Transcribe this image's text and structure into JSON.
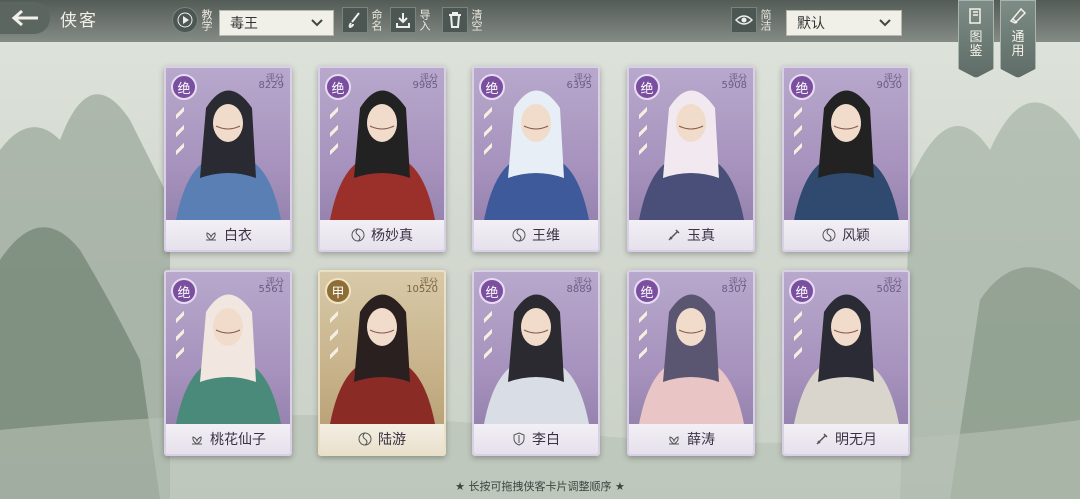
{
  "header": {
    "title": "侠客",
    "tutorial_label": "教学",
    "filter_selected": "毒王",
    "rename_label": "命名",
    "import_label": "导入",
    "clear_label": "清空",
    "simple_label": "简洁",
    "sort_selected": "默认",
    "atlas_label": "图鉴",
    "general_label": "通用"
  },
  "score_label": "评分",
  "cards": [
    {
      "rank": "绝",
      "score": "8229",
      "name": "白衣",
      "icon": "lotus-icon",
      "tier": "purple"
    },
    {
      "rank": "绝",
      "score": "9985",
      "name": "杨妙真",
      "icon": "swirl-icon",
      "tier": "purple"
    },
    {
      "rank": "绝",
      "score": "6395",
      "name": "王维",
      "icon": "swirl-icon",
      "tier": "purple"
    },
    {
      "rank": "绝",
      "score": "5908",
      "name": "玉真",
      "icon": "sword-icon",
      "tier": "purple"
    },
    {
      "rank": "绝",
      "score": "9030",
      "name": "风颖",
      "icon": "swirl-icon",
      "tier": "purple"
    },
    {
      "rank": "绝",
      "score": "5561",
      "name": "桃花仙子",
      "icon": "lotus-icon",
      "tier": "purple"
    },
    {
      "rank": "甲",
      "score": "10520",
      "name": "陆游",
      "icon": "swirl-icon",
      "tier": "gold"
    },
    {
      "rank": "绝",
      "score": "8889",
      "name": "李白",
      "icon": "shield-icon",
      "tier": "purple"
    },
    {
      "rank": "绝",
      "score": "8307",
      "name": "薛涛",
      "icon": "lotus-icon",
      "tier": "purple"
    },
    {
      "rank": "绝",
      "score": "5082",
      "name": "明无月",
      "icon": "sword-icon",
      "tier": "purple"
    }
  ],
  "footer": {
    "hint": "★ 长按可拖拽侠客卡片调整顺序 ★"
  },
  "colors": {
    "purple_card": "#a692bd",
    "gold_card": "#c7b28a",
    "topbar": "#3c4440"
  }
}
